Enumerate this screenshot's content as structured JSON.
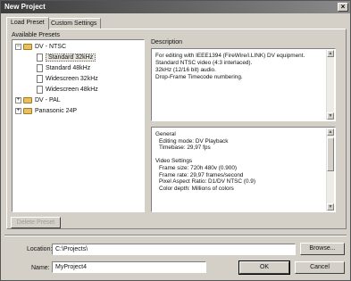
{
  "window": {
    "title": "New Project",
    "close_glyph": "×"
  },
  "tabs": [
    {
      "label": "Load Preset",
      "active": true
    },
    {
      "label": "Custom Settings",
      "active": false
    }
  ],
  "presets": {
    "heading": "Available Presets",
    "tree": [
      {
        "label": "DV - NTSC",
        "type": "folder",
        "expanded": true,
        "expander": "−"
      },
      {
        "label": "Standard 32kHz",
        "type": "preset",
        "selected": true
      },
      {
        "label": "Standard 48kHz",
        "type": "preset"
      },
      {
        "label": "Widescreen 32kHz",
        "type": "preset"
      },
      {
        "label": "Widescreen 48kHz",
        "type": "preset"
      },
      {
        "label": "DV - PAL",
        "type": "folder",
        "expanded": false,
        "expander": "+"
      },
      {
        "label": "Panasonic 24P",
        "type": "folder",
        "expanded": false,
        "expander": "+"
      }
    ],
    "delete_label": "Delete Preset"
  },
  "description": {
    "heading": "Description",
    "lines": [
      "For editing with IEEE1394 (FireWire/i.LINK) DV equipment.",
      "Standard NTSC video (4:3 interlaced).",
      "32kHz (12/16 bit) audio.",
      "Drop-Frame Timecode numbering."
    ]
  },
  "details": {
    "lines": [
      "General",
      "  Editing mode: DV Playback",
      "  Timebase: 29,97 fps",
      "",
      "Video Settings",
      "  Frame size: 720h 480v (0.900)",
      "  Frame rate: 29,97 frames/second",
      "  Pixel Aspect Ratio: D1/DV NTSC (0.9)",
      "  Color depth: Millions of colors"
    ]
  },
  "location": {
    "label": "Location:",
    "value": "C:\\Projects\\",
    "browse_label": "Browse..."
  },
  "name": {
    "label": "Name:",
    "value": "MyProject4"
  },
  "buttons": {
    "ok": "OK",
    "cancel": "Cancel"
  },
  "scroll_glyphs": {
    "up": "▲",
    "down": "▼"
  },
  "colors": {
    "titlebar_start": "#3c3c3c",
    "dialog_bg": "#d4d0c8",
    "folder": "#e8c060"
  }
}
